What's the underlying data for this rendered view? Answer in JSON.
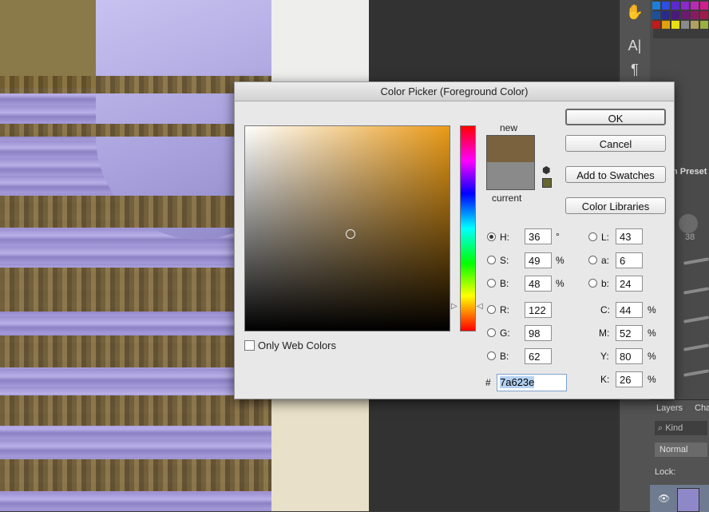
{
  "dialog": {
    "title": "Color Picker (Foreground Color)",
    "buttons": {
      "ok": "OK",
      "cancel": "Cancel",
      "add_swatches": "Add to Swatches",
      "color_libraries": "Color Libraries"
    },
    "swatch": {
      "new_label": "new",
      "current_label": "current",
      "new_color": "#7a623e",
      "current_color": "#8a8a8a"
    },
    "only_web_colors": {
      "label": "Only Web Colors",
      "checked": false
    },
    "hsb": [
      {
        "label": "H:",
        "value": "36",
        "unit": "°",
        "selected": true
      },
      {
        "label": "S:",
        "value": "49",
        "unit": "%",
        "selected": false
      },
      {
        "label": "B:",
        "value": "48",
        "unit": "%",
        "selected": false
      }
    ],
    "rgb": [
      {
        "label": "R:",
        "value": "122"
      },
      {
        "label": "G:",
        "value": "98"
      },
      {
        "label": "B:",
        "value": "62"
      }
    ],
    "lab": [
      {
        "label": "L:",
        "value": "43"
      },
      {
        "label": "a:",
        "value": "6"
      },
      {
        "label": "b:",
        "value": "24"
      }
    ],
    "cmyk": [
      {
        "label": "C:",
        "value": "44",
        "unit": "%"
      },
      {
        "label": "M:",
        "value": "52",
        "unit": "%"
      },
      {
        "label": "Y:",
        "value": "80",
        "unit": "%"
      },
      {
        "label": "K:",
        "value": "26",
        "unit": "%"
      }
    ],
    "hex_prefix": "#",
    "hex": "7a623e",
    "websafe_color": "#666633"
  },
  "background": {
    "panel_label": "h Preset",
    "brush_size": "38",
    "layers": {
      "tab1": "Layers",
      "tab2": "Cha",
      "kind": "Kind",
      "blend": "Normal",
      "lock": "Lock:"
    }
  }
}
